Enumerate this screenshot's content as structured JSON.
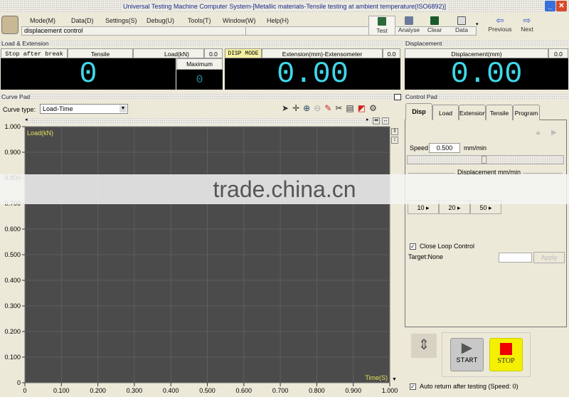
{
  "window": {
    "title": "Universal Testing Machine Computer System-[Metallic materials-Tensile testing at ambient temperature(ISO6892)]"
  },
  "menu": [
    "Mode(M)",
    "Data(D)",
    "Settings(S)",
    "Debug(U)",
    "Tools(T)",
    "Window(W)",
    "Help(H)"
  ],
  "status": "displacement control",
  "toolbar": {
    "test": "Test",
    "analyse": "Analyse",
    "clear": "Clear",
    "data": "Data",
    "previous": "Previous",
    "next": "Next"
  },
  "load_ext": {
    "title": "Load & Extension",
    "stop_after_break": "Stop after break",
    "tensile": "Tensile",
    "load_label": "Load(kN)",
    "load_small": "0.0",
    "load_value": "0",
    "maximum_label": "Maximum",
    "maximum_value": "0",
    "disp_mode": "DISP MODE",
    "ext_label": "Extension(mm)-Extensometer",
    "ext_small": "0.0",
    "ext_value": "0.00"
  },
  "displacement": {
    "title": "Displacement",
    "label": "Displacement(mm)",
    "small": "0.0",
    "value": "0.00"
  },
  "curve": {
    "title": "Curve Pad",
    "type_label": "Curve type:",
    "type_value": "Load-Time"
  },
  "chart_data": {
    "type": "line",
    "title": "",
    "ylabel": "Load(kN)",
    "xlabel": "Time(S)",
    "xlim": [
      0,
      1
    ],
    "ylim": [
      0,
      1
    ],
    "grid": true,
    "series": [],
    "xticks": [
      "0",
      "0.100",
      "0.200",
      "0.300",
      "0.400",
      "0.500",
      "0.600",
      "0.700",
      "0.800",
      "0.900",
      "1.000"
    ],
    "yticks": [
      "0",
      "0.100",
      "0.200",
      "0.300",
      "0.400",
      "0.500",
      "0.600",
      "0.700",
      "0.800",
      "0.900",
      "1.000"
    ]
  },
  "control": {
    "title": "Control Pad",
    "tabs": [
      "Disp",
      "Load",
      "Extension",
      "Tensile",
      "Program"
    ],
    "speed_label": "Speed",
    "speed_value": "0.500",
    "speed_unit": "mm/min",
    "group_label": "Displacement mm/min",
    "presets": [
      "10",
      "20",
      "50"
    ],
    "close_loop": "Close Loop Control",
    "target": "Target:None",
    "apply": "Apply",
    "start": "START",
    "stop": "STOP",
    "auto_return": "Auto return after testing (Speed: 0)"
  },
  "watermark": "trade.china.cn"
}
